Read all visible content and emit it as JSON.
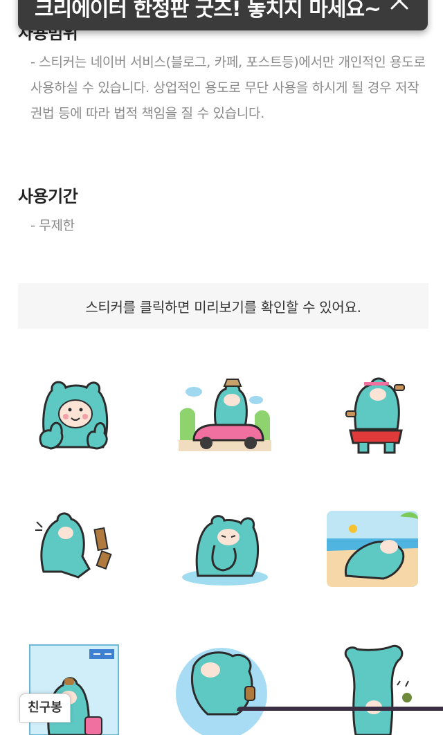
{
  "toast": {
    "text": "크리에이터 한정판 굿즈! 놓치지 마세요~",
    "close_icon": "close-icon"
  },
  "usage_scope": {
    "title": "사용범위",
    "body": "- 스티커는 네이버 서비스(블로그, 카페, 포스트등)에서만 개인적인 용도로 사용하실 수 있습니다. 상업적인 용도로 무단 사용을 하시게 될 경우 저작권법 등에 따라 법적 책임을 질 수 있습니다."
  },
  "usage_period": {
    "title": "사용기간",
    "body": "- 무제한"
  },
  "preview_notice": "스티커를 클릭하면 미리보기를 확인할 수 있어요.",
  "stickers": [
    "bear-thumbs-up-sticker",
    "bear-driving-car-sticker",
    "bear-dumbbell-sticker",
    "bear-angry-kick-sticker",
    "bear-crying-sticker",
    "bear-beach-sunbathing-sticker",
    "bear-airport-travel-sticker",
    "bear-floating-water-sticker",
    "bear-stretching-sticker"
  ],
  "friend_button": "친구봉",
  "colors": {
    "bear": "#5ec8c3",
    "bear_outline": "#2b2b2b",
    "toast_bg": "#3b3b3b",
    "notice_bg": "#f6f6f6"
  }
}
